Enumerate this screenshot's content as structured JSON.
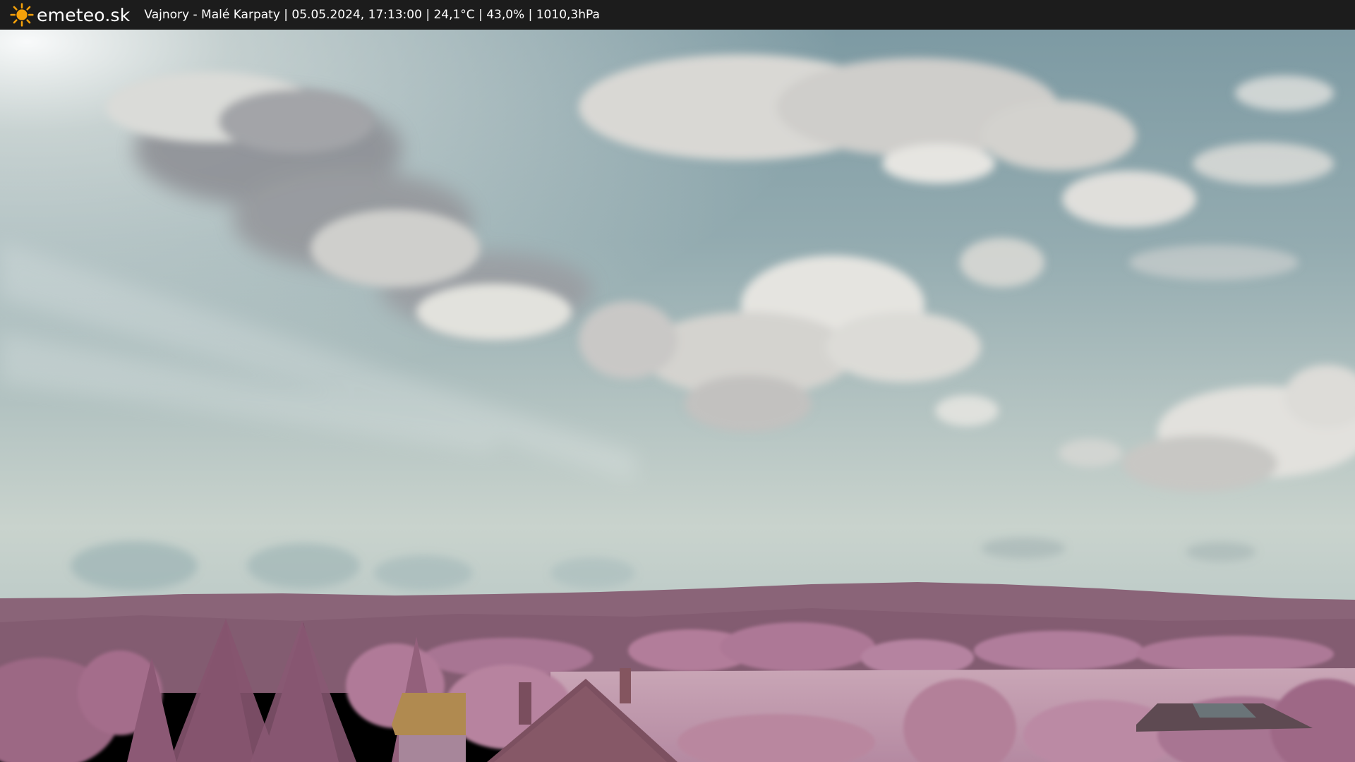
{
  "header": {
    "brand": "emeteo.sk",
    "logo_icon": "sun-icon",
    "camera_info": "Vajnory - Malé Karpaty | 05.05.2024, 17:13:00 | 24,1°C | 43,0% | 1010,3hPa"
  },
  "colors": {
    "topbar": "#1c1c1c",
    "sun": "#f5a10a",
    "sky_top": "#7d9aa3",
    "sky_horizon": "#c9d3cd",
    "hills": "#8a6478",
    "foliage": "#b07a98",
    "field": "#c9a6b6"
  }
}
